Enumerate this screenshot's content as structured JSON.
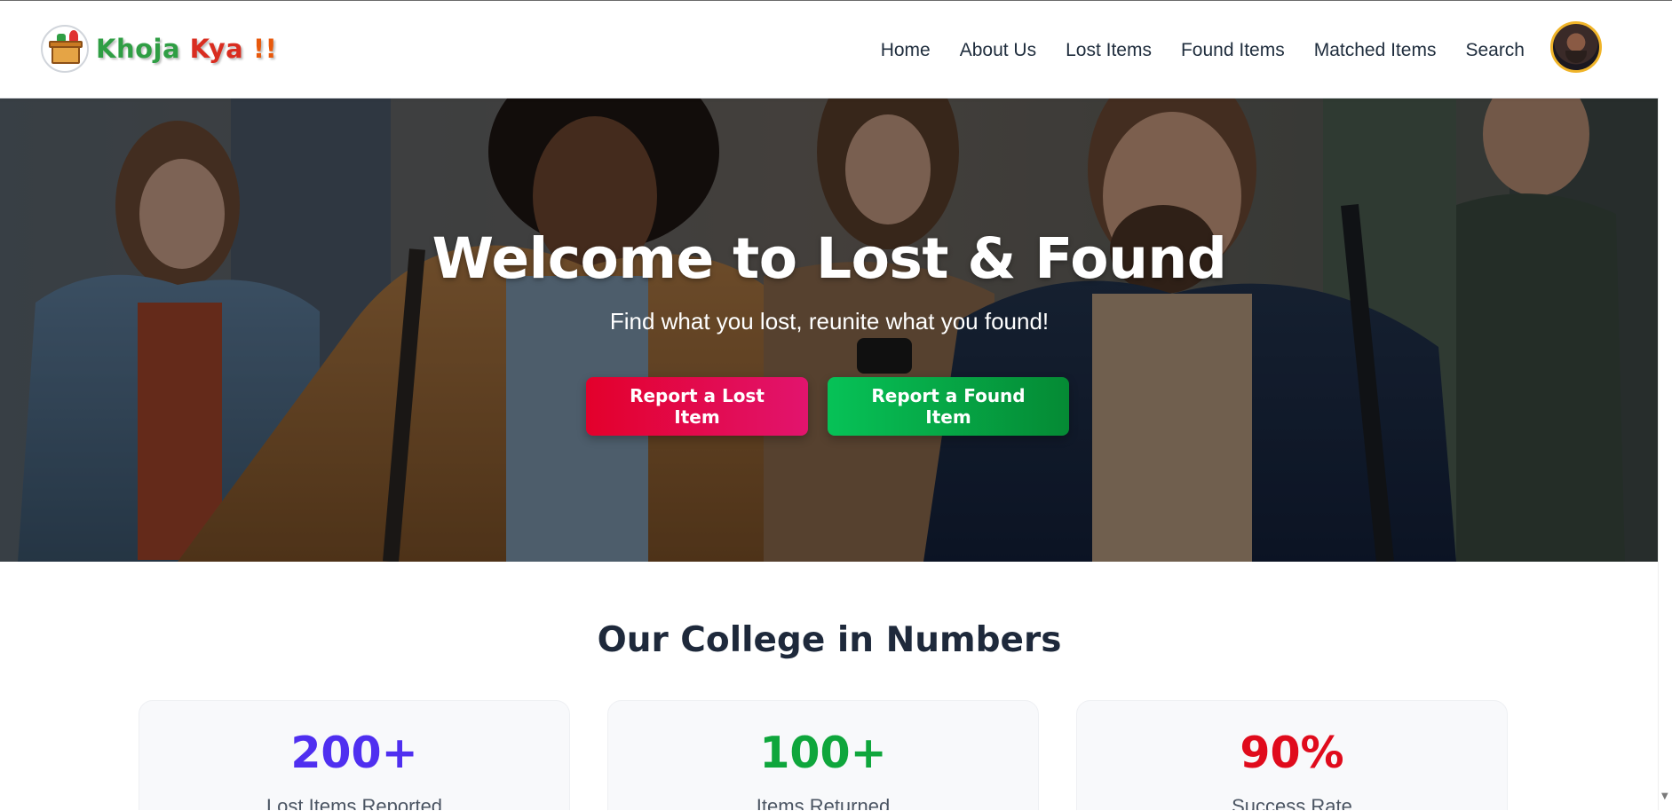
{
  "brand": {
    "name_part1": "Khoja",
    "name_part2": " Kya",
    "name_part3": " !!"
  },
  "nav": {
    "items": [
      {
        "label": "Home"
      },
      {
        "label": "About Us"
      },
      {
        "label": "Lost Items"
      },
      {
        "label": "Found Items"
      },
      {
        "label": "Matched Items"
      },
      {
        "label": "Search"
      }
    ]
  },
  "hero": {
    "title": "Welcome to Lost & Found",
    "subtitle": "Find what you lost, reunite what you found!",
    "report_lost_label": "Report a Lost Item",
    "report_found_label": "Report a Found Item"
  },
  "stats": {
    "title": "Our College in Numbers",
    "cards": [
      {
        "value": "200+",
        "label": "Lost Items Reported",
        "color": "#4f2ff0"
      },
      {
        "value": "100+",
        "label": "Items Returned",
        "color": "#0fa63c"
      },
      {
        "value": "90%",
        "label": "Success Rate",
        "color": "#e00b1c"
      }
    ]
  },
  "colors": {
    "lost_button": "#e3002b",
    "found_button": "#06c257",
    "nav_text": "#1f2d3d",
    "avatar_ring": "#f0b429"
  }
}
